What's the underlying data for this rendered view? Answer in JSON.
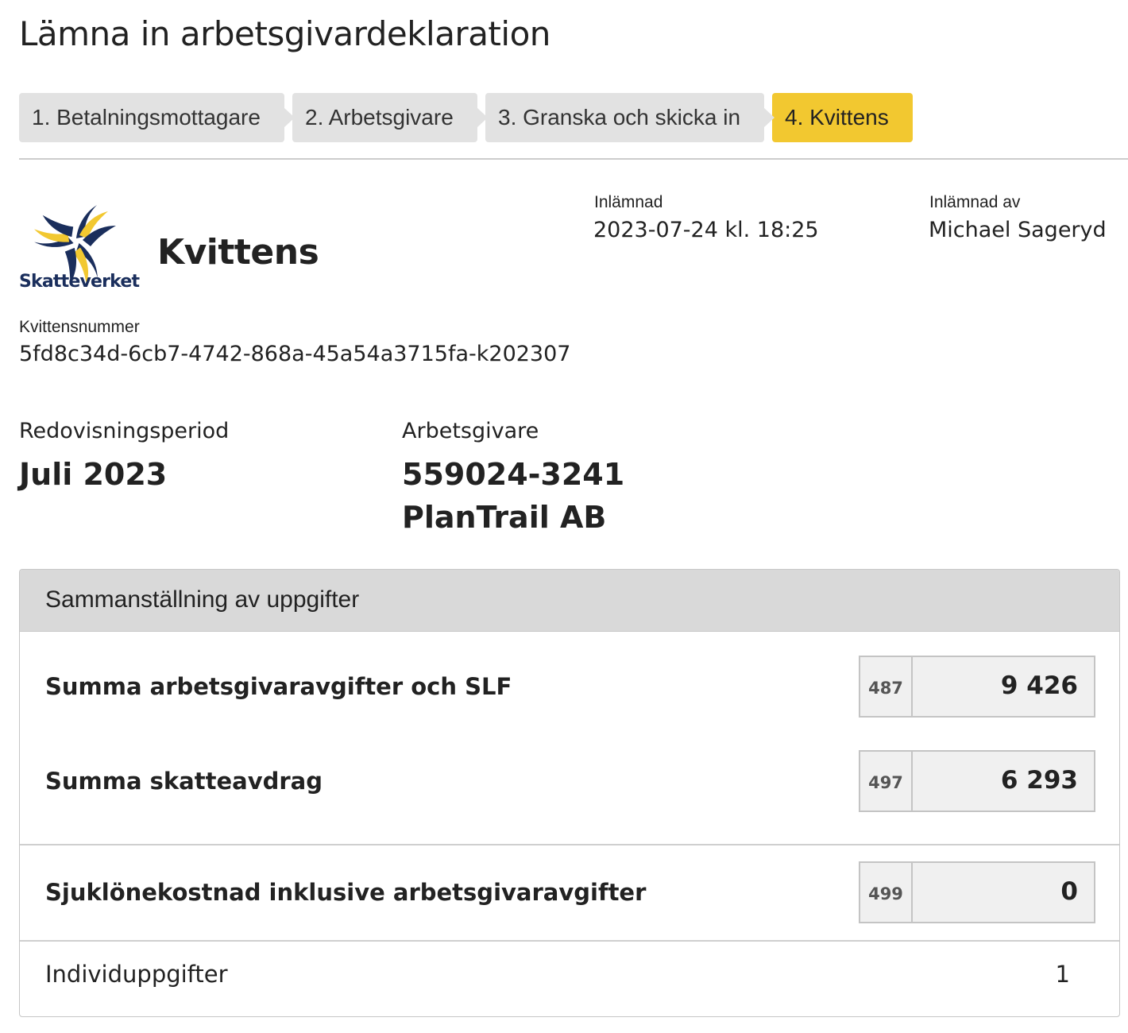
{
  "page": {
    "title": "Lämna in arbetsgivardeklaration"
  },
  "steps": [
    {
      "label": "1. Betalningsmottagare",
      "active": false
    },
    {
      "label": "2. Arbetsgivare",
      "active": false
    },
    {
      "label": "3. Granska och skicka in",
      "active": false
    },
    {
      "label": "4. Kvittens",
      "active": true
    }
  ],
  "receipt": {
    "logo_text": "Skatteverket",
    "title": "Kvittens",
    "submitted_label": "Inlämnad",
    "submitted_value": "2023-07-24 kl. 18:25",
    "submitted_by_label": "Inlämnad av",
    "submitted_by_value": "Michael Sageryd",
    "number_label": "Kvittensnummer",
    "number_value": "5fd8c34d-6cb7-4742-868a-45a54a3715fa-k202307"
  },
  "period": {
    "label": "Redovisningsperiod",
    "value": "Juli 2023"
  },
  "employer": {
    "label": "Arbetsgivare",
    "org_number": "559024-3241",
    "name": "PlanTrail AB"
  },
  "summary": {
    "heading": "Sammanställning av uppgifter",
    "rows": [
      {
        "label": "Summa arbetsgivaravgifter och SLF",
        "code": "487",
        "value": "9 426"
      },
      {
        "label": "Summa skatteavdrag",
        "code": "497",
        "value": "6 293"
      },
      {
        "label": "Sjuklönekostnad inklusive arbetsgivaravgifter",
        "code": "499",
        "value": "0"
      }
    ],
    "individ_label": "Individuppgifter",
    "individ_value": "1"
  },
  "colors": {
    "active_step": "#f2c830",
    "inactive_step": "#e2e2e2",
    "logo_navy": "#1a2e5c",
    "logo_yellow": "#f2c830"
  }
}
